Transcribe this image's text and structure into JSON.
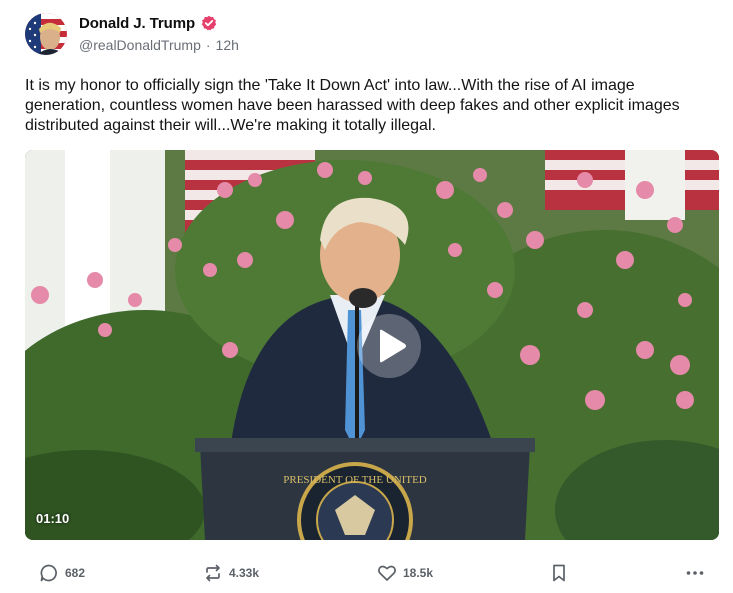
{
  "author": {
    "display_name": "Donald J. Trump",
    "handle": "@realDonaldTrump",
    "separator": "·",
    "time": "12h",
    "verified_color": "#e53f6b"
  },
  "post": {
    "text": "It is my honor to officially sign the 'Take It Down Act' into law...With the rise of AI image generation, countless women have been harassed with deep fakes and other explicit images distributed against their will...We're making it totally illegal."
  },
  "video": {
    "duration": "01:10",
    "seal_text": "PRESIDENT OF THE UNITED"
  },
  "actions": {
    "replies": "682",
    "reposts": "4.33k",
    "likes": "18.5k"
  },
  "icons": [
    "verified-badge-icon",
    "play-icon",
    "reply-icon",
    "repost-icon",
    "like-icon",
    "bookmark-icon",
    "more-icon"
  ]
}
